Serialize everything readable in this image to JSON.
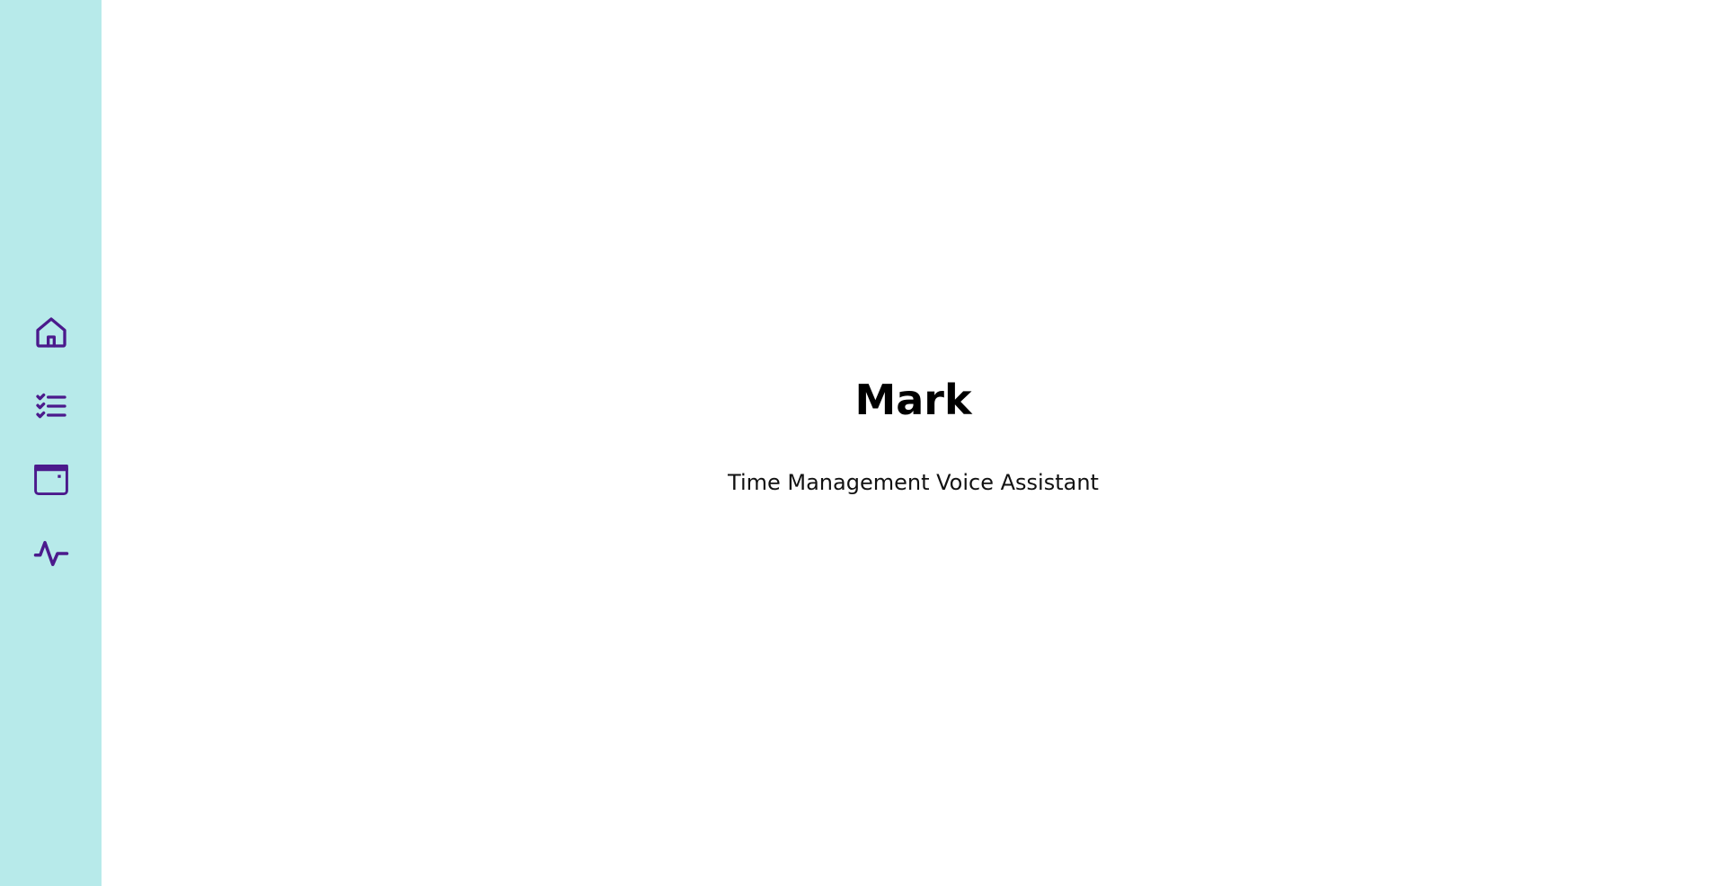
{
  "theme": {
    "sidebar_bg": "#b7eaea",
    "icon_color": "#4b1a8c",
    "background": "#ffffff"
  },
  "sidebar": {
    "items": [
      {
        "icon": "home-icon"
      },
      {
        "icon": "checklist-icon"
      },
      {
        "icon": "calendar-icon"
      },
      {
        "icon": "activity-icon"
      }
    ]
  },
  "main": {
    "title": "Mark",
    "subtitle": "Time Management Voice Assistant"
  }
}
